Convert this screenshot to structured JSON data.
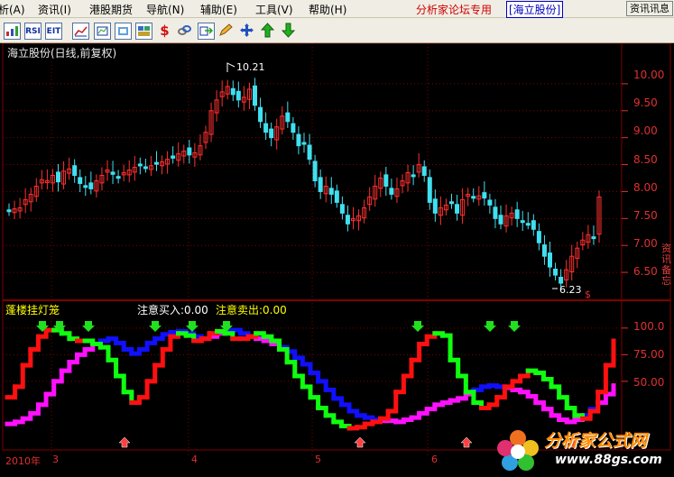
{
  "menubar": {
    "items": [
      "析(A)",
      "资讯(I)",
      "港股期货",
      "导航(N)",
      "辅助(E)",
      "工具(V)",
      "帮助(H)"
    ],
    "forum_label": "分析家论坛专用",
    "stock_tag": "[海立股份]",
    "corner_button": "资讯讯息"
  },
  "toolbar": {
    "icons": [
      "bar-chart-icon",
      "rsi-icon",
      "ett-icon",
      "chart-grid-icon",
      "market-chart-icon",
      "refresh-icon",
      "dollar-icon",
      "link-icon",
      "export-icon",
      "pencil-icon",
      "move-icon",
      "arrow-up-icon",
      "arrow-down-icon"
    ],
    "rsi": "RSI",
    "ett": "EIT",
    "dollar": "$"
  },
  "price_panel": {
    "title": "海立股份(日线,前复权)",
    "high_label": "10.21",
    "low_label": "6.23",
    "marker": "$",
    "y_ticks": [
      "10.00",
      "9.50",
      "9.00",
      "8.50",
      "8.00",
      "7.50",
      "7.00",
      "6.50"
    ]
  },
  "indicator_panel": {
    "title": "蓬楼挂灯笼",
    "buy_text": "注意买入:0.00",
    "sell_text": "注意卖出:0.00",
    "y_ticks": [
      "100.0",
      "75.00",
      "50.00"
    ]
  },
  "x_axis": {
    "labels": [
      "2010年",
      "3",
      "4",
      "5",
      "6"
    ]
  },
  "side_text": "资讯备忘",
  "watermark": {
    "brand": "分析家公式网",
    "url": "www.88gs.com"
  },
  "colors": {
    "up_candle": "#ff3030",
    "down_candle": "#40e0f0",
    "grid": "#800000",
    "line_red": "#ff1010",
    "line_green": "#10ff10",
    "line_blue": "#1010ff",
    "line_magenta": "#ff10ff"
  },
  "chart_data": [
    {
      "type": "candlestick",
      "title": "海立股份(日线,前复权)",
      "ylim": [
        6.1,
        10.45
      ],
      "y_ticks": [
        10.0,
        9.5,
        9.0,
        8.5,
        8.0,
        7.5,
        7.0,
        6.5
      ],
      "x_labels": [
        "2010年",
        "3",
        "4",
        "5",
        "6"
      ],
      "annotations": [
        {
          "label": "10.21",
          "value": 10.21
        },
        {
          "label": "6.23",
          "value": 6.23
        }
      ],
      "closes": [
        7.65,
        7.68,
        7.7,
        7.85,
        7.95,
        8.1,
        8.22,
        8.2,
        8.3,
        8.18,
        8.38,
        8.42,
        8.3,
        8.15,
        8.1,
        8.05,
        8.2,
        8.3,
        8.4,
        8.32,
        8.25,
        8.35,
        8.4,
        8.45,
        8.5,
        8.45,
        8.48,
        8.52,
        8.55,
        8.6,
        8.62,
        8.7,
        8.75,
        8.68,
        8.72,
        8.85,
        9.1,
        9.5,
        9.7,
        9.85,
        9.95,
        9.8,
        9.7,
        9.75,
        9.9,
        9.6,
        9.3,
        9.1,
        9.0,
        9.2,
        9.4,
        9.3,
        9.1,
        8.85,
        8.9,
        8.6,
        8.2,
        8.0,
        8.1,
        7.95,
        7.8,
        7.6,
        7.4,
        7.5,
        7.55,
        7.7,
        7.9,
        8.1,
        8.25,
        8.1,
        7.95,
        8.05,
        8.2,
        8.35,
        8.3,
        8.5,
        8.3,
        7.8,
        7.6,
        7.7,
        7.75,
        7.8,
        7.6,
        7.85,
        7.95,
        7.9,
        7.92,
        7.88,
        7.75,
        7.5,
        7.4,
        7.55,
        7.6,
        7.5,
        7.45,
        7.4,
        7.3,
        7.05,
        6.8,
        6.6,
        6.45,
        6.3,
        6.55,
        6.8,
        6.95,
        7.1,
        7.2,
        7.15,
        7.9
      ]
    },
    {
      "type": "line",
      "title": "蓬楼挂灯笼",
      "ylim": [
        0,
        110
      ],
      "y_ticks": [
        100.0,
        75.0,
        50.0
      ],
      "series": [],
      "line_a": [
        35,
        45,
        65,
        80,
        92,
        98,
        98,
        95,
        90,
        88,
        88,
        85,
        82,
        70,
        55,
        40,
        30,
        35,
        50,
        65,
        80,
        92,
        95,
        93,
        88,
        90,
        95,
        97,
        95,
        90,
        90,
        92,
        95,
        92,
        88,
        80,
        68,
        55,
        45,
        35,
        25,
        18,
        12,
        8,
        6,
        7,
        10,
        12,
        15,
        22,
        40,
        55,
        70,
        85,
        92,
        95,
        93,
        70,
        55,
        40,
        30,
        25,
        28,
        35,
        45,
        50,
        55,
        60,
        58,
        52,
        45,
        35,
        25,
        18,
        15,
        22,
        40,
        65,
        88
      ],
      "line_b": [
        10,
        12,
        15,
        20,
        28,
        38,
        50,
        60,
        68,
        75,
        80,
        85,
        88,
        90,
        86,
        80,
        76,
        80,
        86,
        90,
        94,
        96,
        97,
        95,
        92,
        90,
        92,
        95,
        97,
        98,
        95,
        92,
        90,
        88,
        85,
        82,
        78,
        72,
        66,
        58,
        50,
        42,
        34,
        28,
        22,
        18,
        16,
        14,
        13,
        13,
        12,
        14,
        16,
        20,
        24,
        28,
        30,
        32,
        34,
        38,
        42,
        45,
        46,
        45,
        44,
        42,
        40,
        36,
        30,
        24,
        18,
        14,
        12,
        14,
        18,
        24,
        30,
        38,
        46
      ]
    }
  ]
}
